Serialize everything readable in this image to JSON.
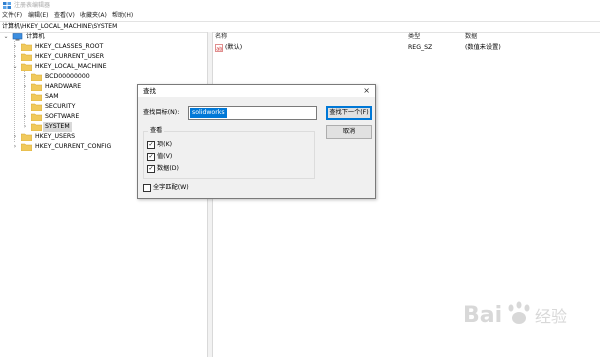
{
  "window": {
    "title": "注册表编辑器"
  },
  "menu": [
    "文件(F)",
    "编辑(E)",
    "查看(V)",
    "收藏夹(A)",
    "帮助(H)"
  ],
  "address": "计算机\\HKEY_LOCAL_MACHINE\\SYSTEM",
  "tree": {
    "root": "计算机",
    "items": [
      {
        "label": "HKEY_CLASSES_ROOT"
      },
      {
        "label": "HKEY_CURRENT_USER"
      },
      {
        "label": "HKEY_LOCAL_MACHINE"
      },
      {
        "label": "BCD00000000"
      },
      {
        "label": "HARDWARE"
      },
      {
        "label": "SAM"
      },
      {
        "label": "SECURITY"
      },
      {
        "label": "SOFTWARE"
      },
      {
        "label": "SYSTEM"
      },
      {
        "label": "HKEY_USERS"
      },
      {
        "label": "HKEY_CURRENT_CONFIG"
      }
    ]
  },
  "list": {
    "columns": [
      "名称",
      "类型",
      "数据"
    ],
    "rows": [
      {
        "name": "(默认)",
        "type": "REG_SZ",
        "data": "(数值未设置)"
      }
    ]
  },
  "dialog": {
    "title": "查找",
    "close": "×",
    "find_label": "查找目标(N):",
    "find_value": "solidworks",
    "find_next": "查找下一个(F)",
    "cancel": "取消",
    "group_label": "查看",
    "options": [
      {
        "label": "项(K)",
        "checked": true
      },
      {
        "label": "值(V)",
        "checked": true
      },
      {
        "label": "数据(D)",
        "checked": true
      }
    ],
    "whole_match": {
      "label": "全字匹配(W)",
      "checked": false
    }
  },
  "watermark": {
    "text1": "Bai",
    "text2": "经验"
  },
  "colors": {
    "selection": "#0078d7",
    "folder": "#f0c95c",
    "dialog_bg": "#f0f0f0"
  }
}
